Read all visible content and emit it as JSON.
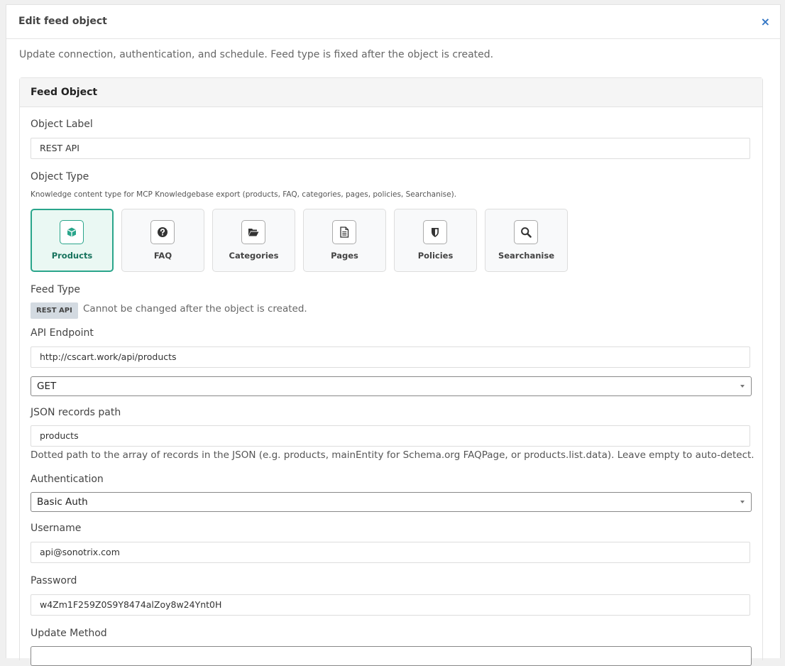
{
  "modal": {
    "title": "Edit feed object",
    "close_label": "×",
    "intro": "Update connection, authentication, and schedule. Feed type is fixed after the object is created."
  },
  "panel": {
    "title": "Feed Object",
    "object_label": {
      "label": "Object Label",
      "value": "REST API"
    },
    "object_type": {
      "label": "Object Type",
      "hint": "Knowledge content type for MCP Knowledgebase export (products, FAQ, categories, pages, policies, Searchanise).",
      "tiles": [
        {
          "label": "Products",
          "icon": "cube-icon",
          "selected": true
        },
        {
          "label": "FAQ",
          "icon": "question-circle-icon",
          "selected": false
        },
        {
          "label": "Categories",
          "icon": "folder-open-icon",
          "selected": false
        },
        {
          "label": "Pages",
          "icon": "file-text-icon",
          "selected": false
        },
        {
          "label": "Policies",
          "icon": "shield-icon",
          "selected": false
        },
        {
          "label": "Searchanise",
          "icon": "search-icon",
          "selected": false
        }
      ]
    },
    "feed_type": {
      "label": "Feed Type",
      "badge": "REST API",
      "note": "Cannot be changed after the object is created."
    },
    "api_endpoint": {
      "label": "API Endpoint",
      "value": "http://cscart.work/api/products",
      "method": "GET"
    },
    "json_path": {
      "label": "JSON records path",
      "value": "products",
      "hint": "Dotted path to the array of records in the JSON (e.g. products, mainEntity for Schema.org FAQPage, or products.list.data). Leave empty to auto-detect."
    },
    "authentication": {
      "label": "Authentication",
      "value": "Basic Auth"
    },
    "username": {
      "label": "Username",
      "value": "api@sonotrix.com"
    },
    "password": {
      "label": "Password",
      "value": "w4Zm1F259Z0S9Y8474alZoy8w24Ynt0H"
    },
    "update_method": {
      "label": "Update Method"
    }
  },
  "colors": {
    "accent": "#2aa58b",
    "close": "#3275c4",
    "badge_bg": "#d3dae1"
  }
}
